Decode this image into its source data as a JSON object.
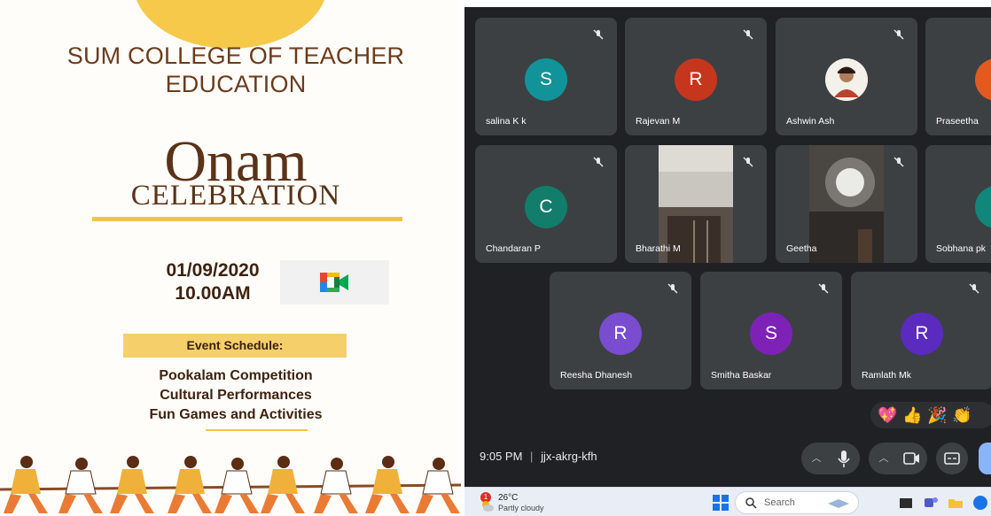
{
  "poster": {
    "college_line1": "SUM COLLEGE OF TEACHER",
    "college_line2": "EDUCATION",
    "title": "Onam",
    "subtitle": "CELEBRATION",
    "date": "01/09/2020",
    "time": "10.00AM",
    "schedule_heading": "Event Schedule:",
    "schedule_items": [
      "Pookalam Competition",
      "Cultural Performances",
      "Fun Games and Activities"
    ],
    "colors": {
      "brown": "#5a3318",
      "gold": "#f3c24b",
      "sun": "#f7c94a"
    }
  },
  "meet": {
    "participants": [
      {
        "name": "salina K k",
        "initial": "S",
        "avatar_color": "#12939a",
        "type": "avatar"
      },
      {
        "name": "Rajevan M",
        "initial": "R",
        "avatar_color": "#c5361d",
        "type": "avatar"
      },
      {
        "name": "Ashwin Ash",
        "initial": "",
        "avatar_color": "#ffffff",
        "type": "photo"
      },
      {
        "name": "Praseetha",
        "initial": "",
        "avatar_color": "#e3591e",
        "type": "avatar"
      },
      {
        "name": "Chandaran P",
        "initial": "C",
        "avatar_color": "#137d6b",
        "type": "avatar"
      },
      {
        "name": "Bharathi M",
        "initial": "",
        "avatar_color": "",
        "type": "video"
      },
      {
        "name": "Geetha",
        "initial": "",
        "avatar_color": "",
        "type": "video"
      },
      {
        "name": "Sobhana pk",
        "initial": "",
        "avatar_color": "#11867a",
        "type": "avatar"
      },
      {
        "name": "Reesha Dhanesh",
        "initial": "R",
        "avatar_color": "#7a4ccf",
        "type": "avatar"
      },
      {
        "name": "Smitha Baskar",
        "initial": "S",
        "avatar_color": "#7e22b7",
        "type": "avatar"
      },
      {
        "name": "Ramlath Mk",
        "initial": "R",
        "avatar_color": "#5b2bbf",
        "type": "avatar"
      }
    ],
    "time": "9:05 PM",
    "meeting_code": "jjx-akrg-kfh",
    "separator": "|",
    "reactions": [
      "💖",
      "👍",
      "🎉",
      "👏"
    ]
  },
  "taskbar": {
    "weather_temp": "26°C",
    "weather_condition": "Partly cloudy",
    "notification_count": "1",
    "search_label": "Search"
  }
}
